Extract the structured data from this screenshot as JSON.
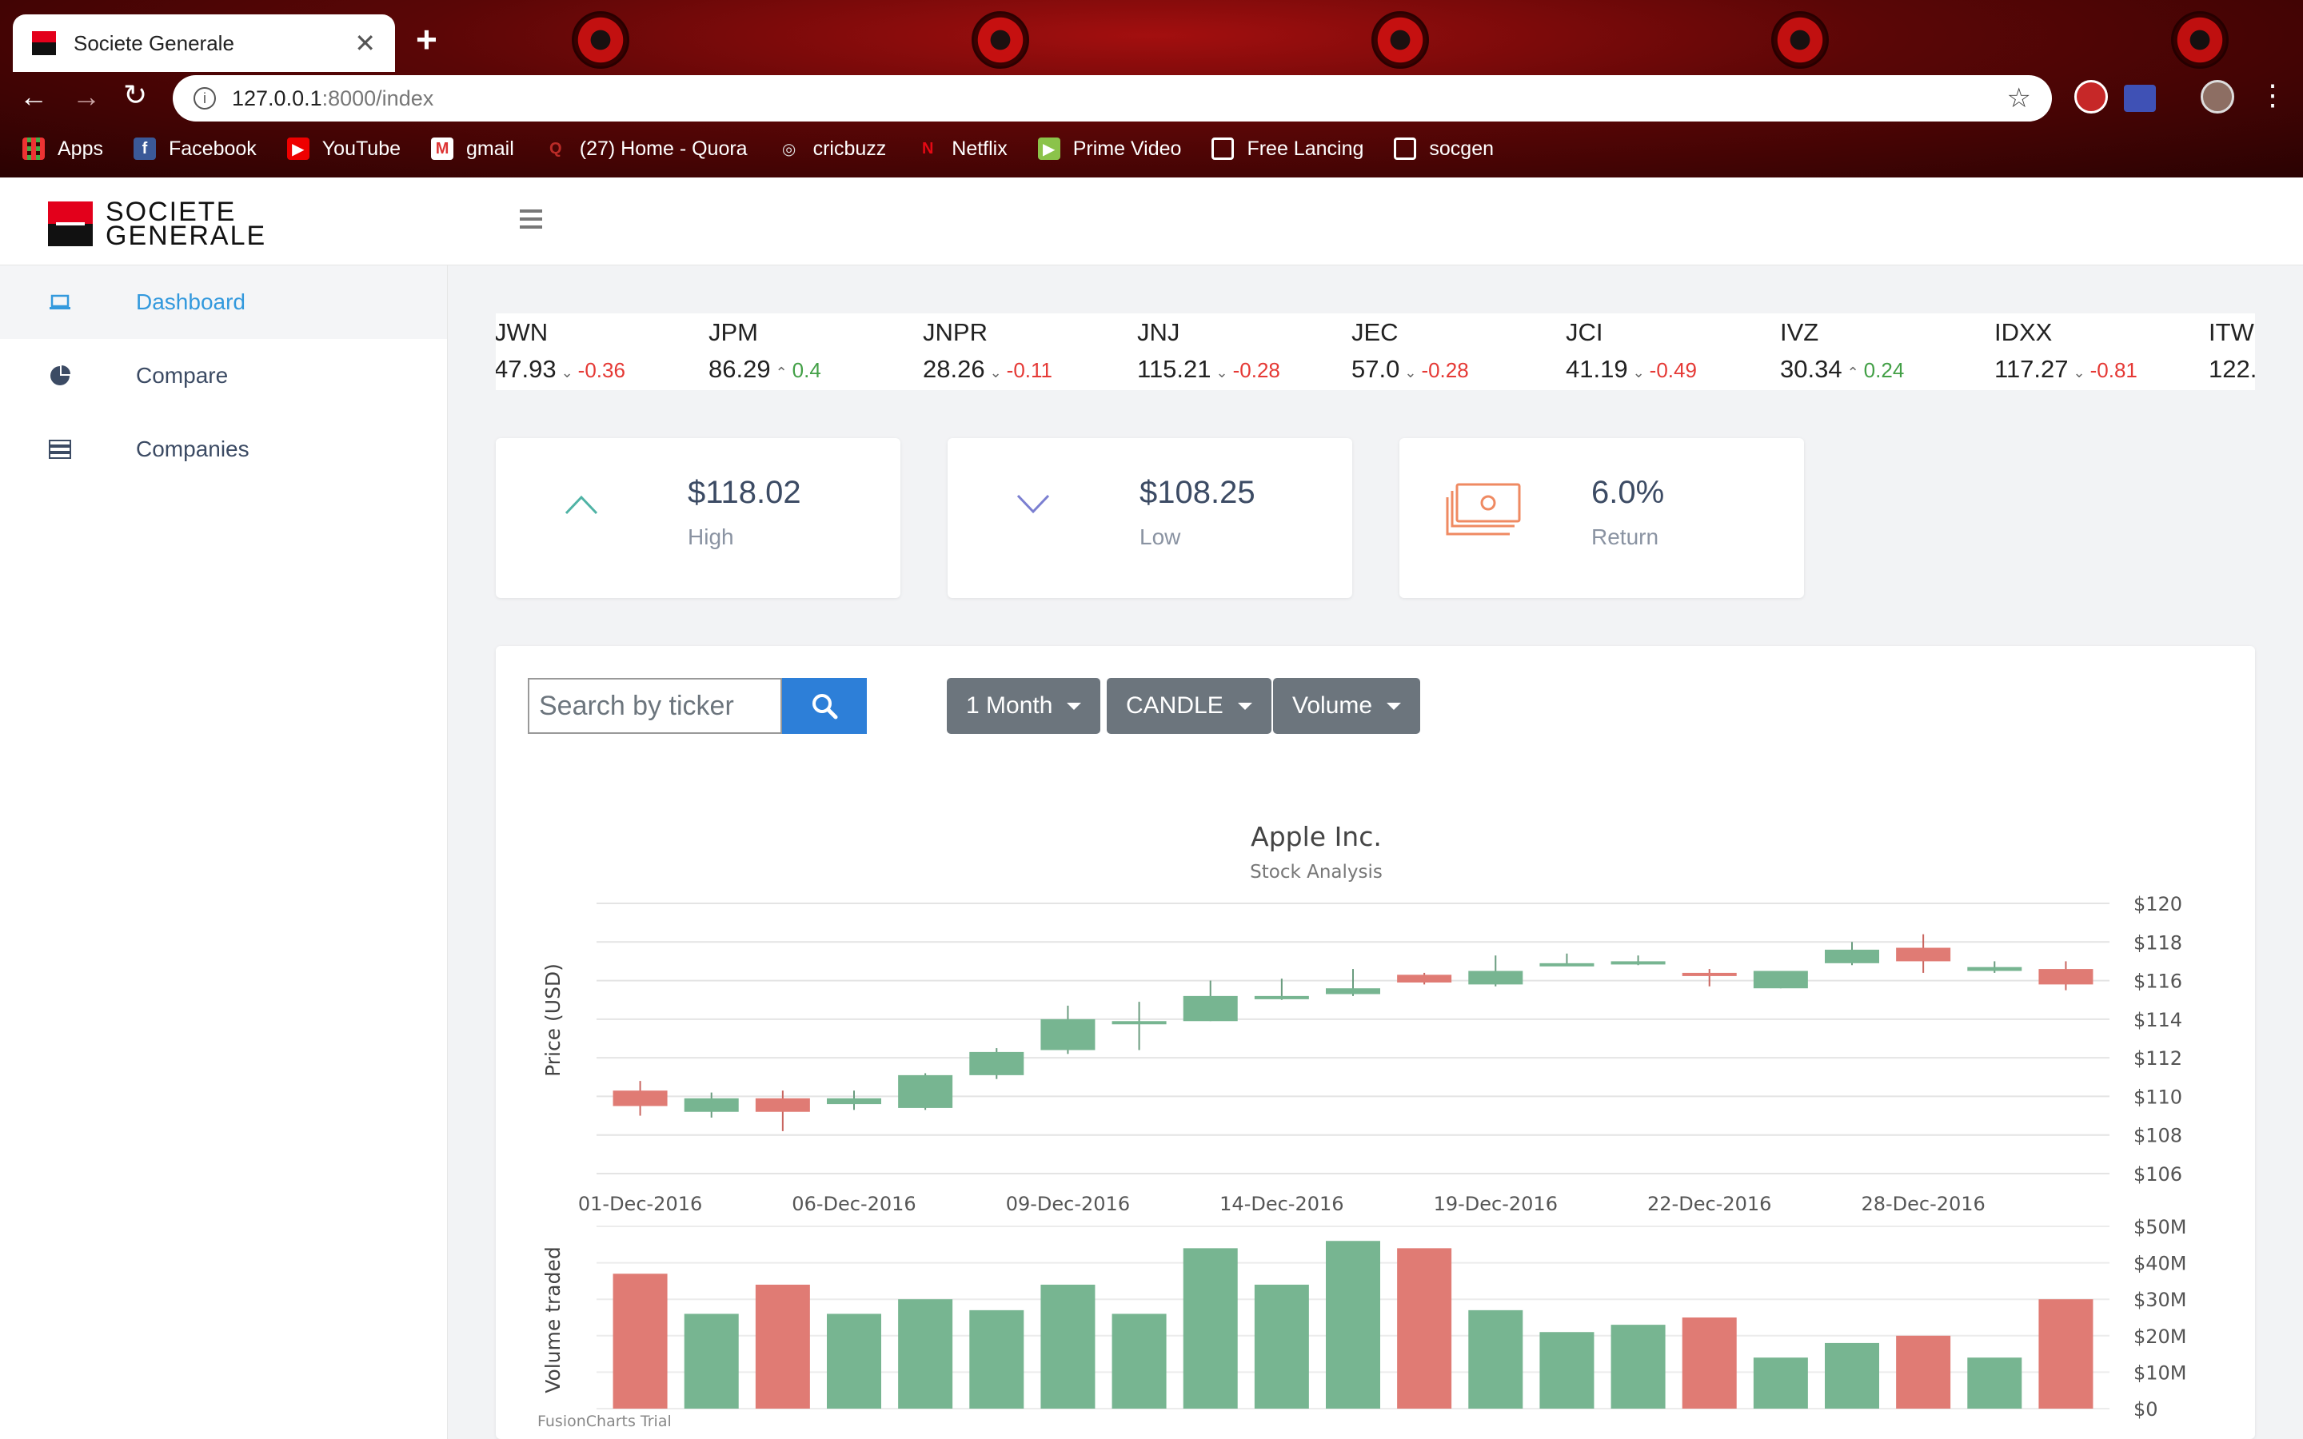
{
  "browser": {
    "tab_title": "Societe Generale",
    "tab_close": "✕",
    "new_tab": "+",
    "url_host": "127.0.0.1",
    "url_rest": ":8000/index",
    "bookmarks": [
      {
        "label": "Apps",
        "icon": "apps-grid-icon"
      },
      {
        "label": "Facebook",
        "icon": "facebook-icon"
      },
      {
        "label": "YouTube",
        "icon": "youtube-icon"
      },
      {
        "label": "gmail",
        "icon": "gmail-icon"
      },
      {
        "label": "(27) Home - Quora",
        "icon": "quora-icon"
      },
      {
        "label": "cricbuzz",
        "icon": "cricbuzz-icon"
      },
      {
        "label": "Netflix",
        "icon": "netflix-icon"
      },
      {
        "label": "Prime Video",
        "icon": "prime-video-icon"
      },
      {
        "label": "Free Lancing",
        "icon": "folder-icon"
      },
      {
        "label": "socgen",
        "icon": "folder-icon"
      }
    ]
  },
  "header": {
    "logo_line1": "SOCIETE",
    "logo_line2": "GENERALE"
  },
  "sidebar": {
    "items": [
      {
        "label": "Dashboard",
        "icon": "laptop-icon",
        "active": true
      },
      {
        "label": "Compare",
        "icon": "pie-chart-icon",
        "active": false
      },
      {
        "label": "Companies",
        "icon": "server-list-icon",
        "active": false
      }
    ]
  },
  "ticker": [
    {
      "symbol": "JWN",
      "price": "47.93",
      "change": "-0.36",
      "dir": "down"
    },
    {
      "symbol": "JPM",
      "price": "86.29",
      "change": "0.4",
      "dir": "up"
    },
    {
      "symbol": "JNPR",
      "price": "28.26",
      "change": "-0.11",
      "dir": "down"
    },
    {
      "symbol": "JNJ",
      "price": "115.21",
      "change": "-0.28",
      "dir": "down"
    },
    {
      "symbol": "JEC",
      "price": "57.0",
      "change": "-0.28",
      "dir": "down"
    },
    {
      "symbol": "JCI",
      "price": "41.19",
      "change": "-0.49",
      "dir": "down"
    },
    {
      "symbol": "IVZ",
      "price": "30.34",
      "change": "0.24",
      "dir": "up"
    },
    {
      "symbol": "IDXX",
      "price": "117.27",
      "change": "-0.81",
      "dir": "down"
    },
    {
      "symbol": "ITW",
      "price": "122.",
      "change": "",
      "dir": ""
    }
  ],
  "stats": [
    {
      "value": "$118.02",
      "label": "High",
      "icon": "chevron-up-icon"
    },
    {
      "value": "$108.25",
      "label": "Low",
      "icon": "chevron-down-icon"
    },
    {
      "value": "6.0%",
      "label": "Return",
      "icon": "money-stack-icon"
    }
  ],
  "controls": {
    "search_placeholder": "Search by ticker",
    "period": "1 Month",
    "chart_type": "CANDLE",
    "volume": "Volume"
  },
  "colors": {
    "up": "#77b591",
    "down": "#e07b74",
    "accent": "#2d7fd8",
    "active_nav": "#3399dd"
  },
  "chart_data": {
    "type": "candlestick",
    "title": "Apple Inc.",
    "subtitle": "Stock Analysis",
    "ylabel_price": "Price (USD)",
    "ylabel_volume": "Volume traded",
    "credit": "FusionCharts Trial",
    "price_ylim": [
      106,
      120
    ],
    "price_ticks": [
      "$120",
      "$118",
      "$116",
      "$114",
      "$112",
      "$110",
      "$108",
      "$106"
    ],
    "volume_ylim": [
      0,
      50
    ],
    "volume_ticks": [
      "$50M",
      "$40M",
      "$30M",
      "$20M",
      "$10M",
      "$0"
    ],
    "x_labels": [
      "01-Dec-2016",
      "06-Dec-2016",
      "09-Dec-2016",
      "14-Dec-2016",
      "19-Dec-2016",
      "22-Dec-2016",
      "28-Dec-2016"
    ],
    "x_label_positions": [
      0,
      3,
      6,
      9,
      12,
      15,
      18
    ],
    "candles": [
      {
        "open": 110.3,
        "close": 109.5,
        "high": 110.8,
        "low": 109.0,
        "volume": 37
      },
      {
        "open": 109.2,
        "close": 109.9,
        "high": 110.2,
        "low": 108.9,
        "volume": 26
      },
      {
        "open": 109.9,
        "close": 109.2,
        "high": 110.3,
        "low": 108.2,
        "volume": 34
      },
      {
        "open": 109.6,
        "close": 109.9,
        "high": 110.3,
        "low": 109.3,
        "volume": 26
      },
      {
        "open": 109.4,
        "close": 111.1,
        "high": 111.2,
        "low": 109.3,
        "volume": 30
      },
      {
        "open": 111.1,
        "close": 112.3,
        "high": 112.5,
        "low": 110.9,
        "volume": 27
      },
      {
        "open": 112.4,
        "close": 114.0,
        "high": 114.7,
        "low": 112.2,
        "volume": 34
      },
      {
        "open": 113.9,
        "close": 113.9,
        "high": 114.9,
        "low": 112.4,
        "volume": 26
      },
      {
        "open": 113.9,
        "close": 115.2,
        "high": 116.0,
        "low": 113.9,
        "volume": 44
      },
      {
        "open": 115.1,
        "close": 115.2,
        "high": 116.1,
        "low": 115.0,
        "volume": 34
      },
      {
        "open": 115.3,
        "close": 115.6,
        "high": 116.6,
        "low": 115.2,
        "volume": 46
      },
      {
        "open": 116.3,
        "close": 115.9,
        "high": 116.4,
        "low": 115.8,
        "volume": 44
      },
      {
        "open": 115.8,
        "close": 116.5,
        "high": 117.3,
        "low": 115.7,
        "volume": 27
      },
      {
        "open": 116.8,
        "close": 116.9,
        "high": 117.4,
        "low": 116.8,
        "volume": 21
      },
      {
        "open": 116.9,
        "close": 117.0,
        "high": 117.3,
        "low": 116.8,
        "volume": 23
      },
      {
        "open": 116.4,
        "close": 116.3,
        "high": 116.6,
        "low": 115.7,
        "volume": 25
      },
      {
        "open": 115.6,
        "close": 116.5,
        "high": 116.5,
        "low": 115.6,
        "volume": 14
      },
      {
        "open": 116.9,
        "close": 117.6,
        "high": 118.0,
        "low": 116.8,
        "volume": 18
      },
      {
        "open": 117.7,
        "close": 117.0,
        "high": 118.4,
        "low": 116.4,
        "volume": 20
      },
      {
        "open": 116.5,
        "close": 116.7,
        "high": 117.0,
        "low": 116.4,
        "volume": 14
      },
      {
        "open": 116.6,
        "close": 115.8,
        "high": 117.0,
        "low": 115.5,
        "volume": 30
      }
    ]
  }
}
